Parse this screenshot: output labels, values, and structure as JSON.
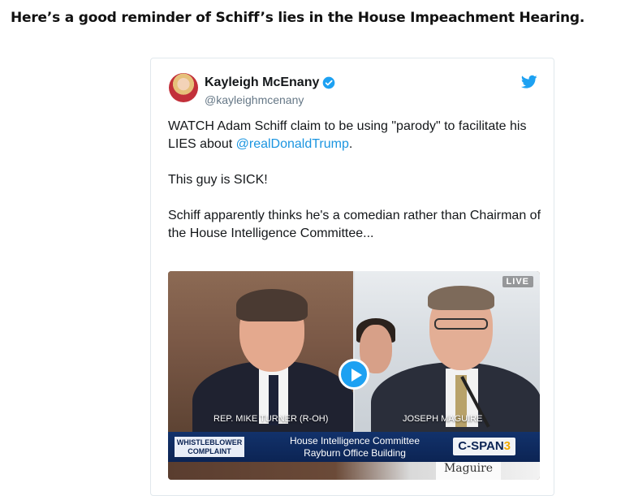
{
  "post": {
    "headline": "Here’s a good reminder of Schiff’s lies in the House Impeachment Hearing."
  },
  "tweet": {
    "author_name": "Kayleigh McEnany",
    "handle": "@kayleighmcenany",
    "verified": true,
    "paragraphs": [
      {
        "before": "WATCH Adam Schiff claim to be using \"parody\" to facilitate his LIES about ",
        "mention": "@realDonaldTrump",
        "after": "."
      },
      {
        "before": "This guy is SICK!",
        "mention": "",
        "after": ""
      },
      {
        "before": "Schiff apparently thinks he's a comedian rather than Chairman of the House Intelligence Committee...",
        "mention": "",
        "after": ""
      }
    ],
    "colors": {
      "link": "#1b95e0",
      "verified": "#1da1f2",
      "bird": "#1da1f2"
    }
  },
  "video": {
    "live_label": "LIVE",
    "left_name": "REP. MIKE TURNER (R-OH)",
    "right_name": "JOSEPH MAGUIRE",
    "chyron_tag": "WHISTLEBLOWER COMPLAINT",
    "chyron_line1": "House Intelligence Committee",
    "chyron_line2": "Rayburn Office Building",
    "network_logo": "C-SPAN",
    "network_number": "3",
    "placard_text": "Maguire",
    "play_icon": "play-icon"
  }
}
